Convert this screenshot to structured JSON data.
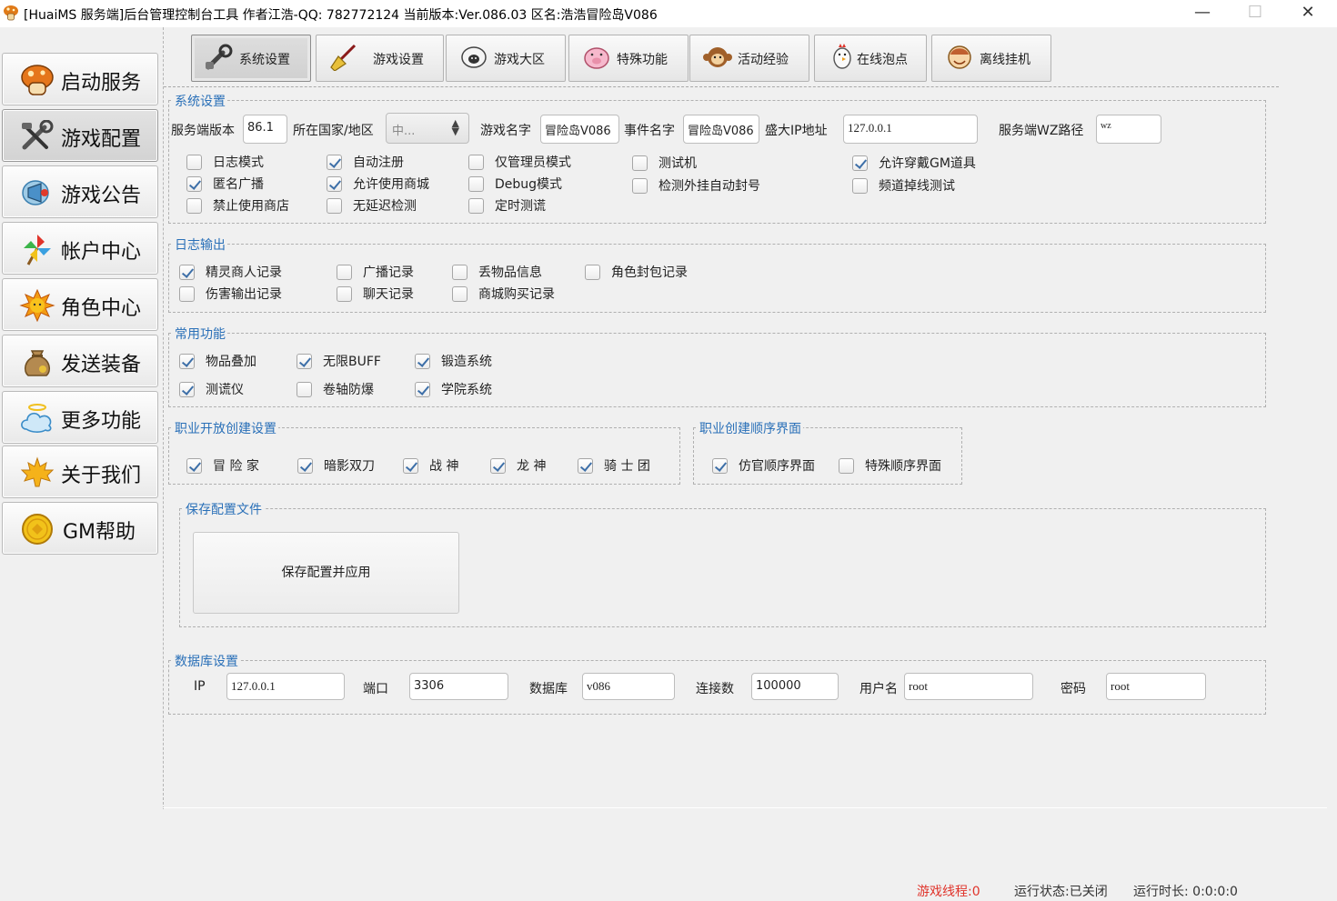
{
  "window": {
    "title": "[HuaiMS 服务端]后台管理控制台工具 作者江浩-QQ:  782772124 当前版本:Ver.086.03  区名:浩浩冒险岛V086",
    "minimize": "—",
    "maximize": "☐",
    "close": "✕"
  },
  "sidebar": {
    "items": [
      {
        "label": "启动服务",
        "icon": "mushroom-icon"
      },
      {
        "label": "游戏配置",
        "icon": "tools-icon"
      },
      {
        "label": "游戏公告",
        "icon": "megaphone-icon"
      },
      {
        "label": "帐户中心",
        "icon": "pinwheel-icon"
      },
      {
        "label": "角色中心",
        "icon": "sun-icon"
      },
      {
        "label": "发送装备",
        "icon": "sack-icon"
      },
      {
        "label": "更多功能",
        "icon": "cloud-icon"
      },
      {
        "label": "关于我们",
        "icon": "maple-leaf-icon"
      },
      {
        "label": "GM帮助",
        "icon": "coin-icon"
      }
    ]
  },
  "tabs": [
    {
      "label": "系统设置",
      "icon": "wrench-icon"
    },
    {
      "label": "游戏设置",
      "icon": "broom-icon"
    },
    {
      "label": "游戏大区",
      "icon": "sheep-icon"
    },
    {
      "label": "特殊功能",
      "icon": "pig-icon"
    },
    {
      "label": "活动经验",
      "icon": "monkey-icon"
    },
    {
      "label": "在线泡点",
      "icon": "chicken-icon"
    },
    {
      "label": "离线挂机",
      "icon": "face-icon"
    }
  ],
  "system": {
    "legend": "系统设置",
    "version_label": "服务端版本",
    "version_value": "86.1",
    "region_label": "所在国家/地区",
    "region_value": "中...",
    "game_name_label": "游戏名字",
    "game_name_value": "冒险岛V086",
    "event_name_label": "事件名字",
    "event_name_value": "冒险岛V086",
    "ip_label": "盛大IP地址",
    "ip_value": "127.0.0.1",
    "wz_label": "服务端WZ路径",
    "wz_value": "wz",
    "checks": [
      {
        "label": "日志模式",
        "checked": false
      },
      {
        "label": "匿名广播",
        "checked": true
      },
      {
        "label": "禁止使用商店",
        "checked": false
      },
      {
        "label": "自动注册",
        "checked": true
      },
      {
        "label": "允许使用商城",
        "checked": true
      },
      {
        "label": "无延迟检测",
        "checked": false
      },
      {
        "label": "仅管理员模式",
        "checked": false
      },
      {
        "label": "Debug模式",
        "checked": false
      },
      {
        "label": "定时测谎",
        "checked": false
      },
      {
        "label": "测试机",
        "checked": false
      },
      {
        "label": "检测外挂自动封号",
        "checked": false
      },
      {
        "label": "允许穿戴GM道具",
        "checked": true
      },
      {
        "label": "频道掉线测试",
        "checked": false
      }
    ]
  },
  "log": {
    "legend": "日志输出",
    "checks": [
      {
        "label": "精灵商人记录",
        "checked": true
      },
      {
        "label": "伤害输出记录",
        "checked": false
      },
      {
        "label": "广播记录",
        "checked": false
      },
      {
        "label": "聊天记录",
        "checked": false
      },
      {
        "label": "丢物品信息",
        "checked": false
      },
      {
        "label": "商城购买记录",
        "checked": false
      },
      {
        "label": "角色封包记录",
        "checked": false
      }
    ]
  },
  "common": {
    "legend": "常用功能",
    "checks": [
      {
        "label": "物品叠加",
        "checked": true
      },
      {
        "label": "测谎仪",
        "checked": true
      },
      {
        "label": "无限BUFF",
        "checked": true
      },
      {
        "label": "卷轴防爆",
        "checked": false
      },
      {
        "label": "锻造系统",
        "checked": true
      },
      {
        "label": "学院系统",
        "checked": true
      }
    ]
  },
  "jobs": {
    "legend": "职业开放创建设置",
    "checks": [
      {
        "label": "冒 险 家",
        "checked": true
      },
      {
        "label": "暗影双刀",
        "checked": true
      },
      {
        "label": "战 神",
        "checked": true
      },
      {
        "label": "龙 神",
        "checked": true
      },
      {
        "label": "骑 士 团",
        "checked": true
      }
    ]
  },
  "order": {
    "legend": "职业创建顺序界面",
    "checks": [
      {
        "label": "仿官顺序界面",
        "checked": true
      },
      {
        "label": "特殊顺序界面",
        "checked": false
      }
    ]
  },
  "save": {
    "legend": "保存配置文件",
    "button": "保存配置并应用"
  },
  "db": {
    "legend": "数据库设置",
    "ip_label": "IP",
    "ip_value": "127.0.0.1",
    "port_label": "端口",
    "port_value": "3306",
    "db_label": "数据库",
    "db_value": "v086",
    "conn_label": "连接数",
    "conn_value": "100000",
    "user_label": "用户名",
    "user_value": "root",
    "pwd_label": "密码",
    "pwd_value": "root"
  },
  "status": {
    "threads": "游戏线程:0",
    "state": "运行状态:已关闭",
    "uptime": "运行时长:  0:0:0:0"
  },
  "colors": {
    "legend": "#2a70b8",
    "threads": "#e0342b",
    "check": "#3d6fa8"
  }
}
